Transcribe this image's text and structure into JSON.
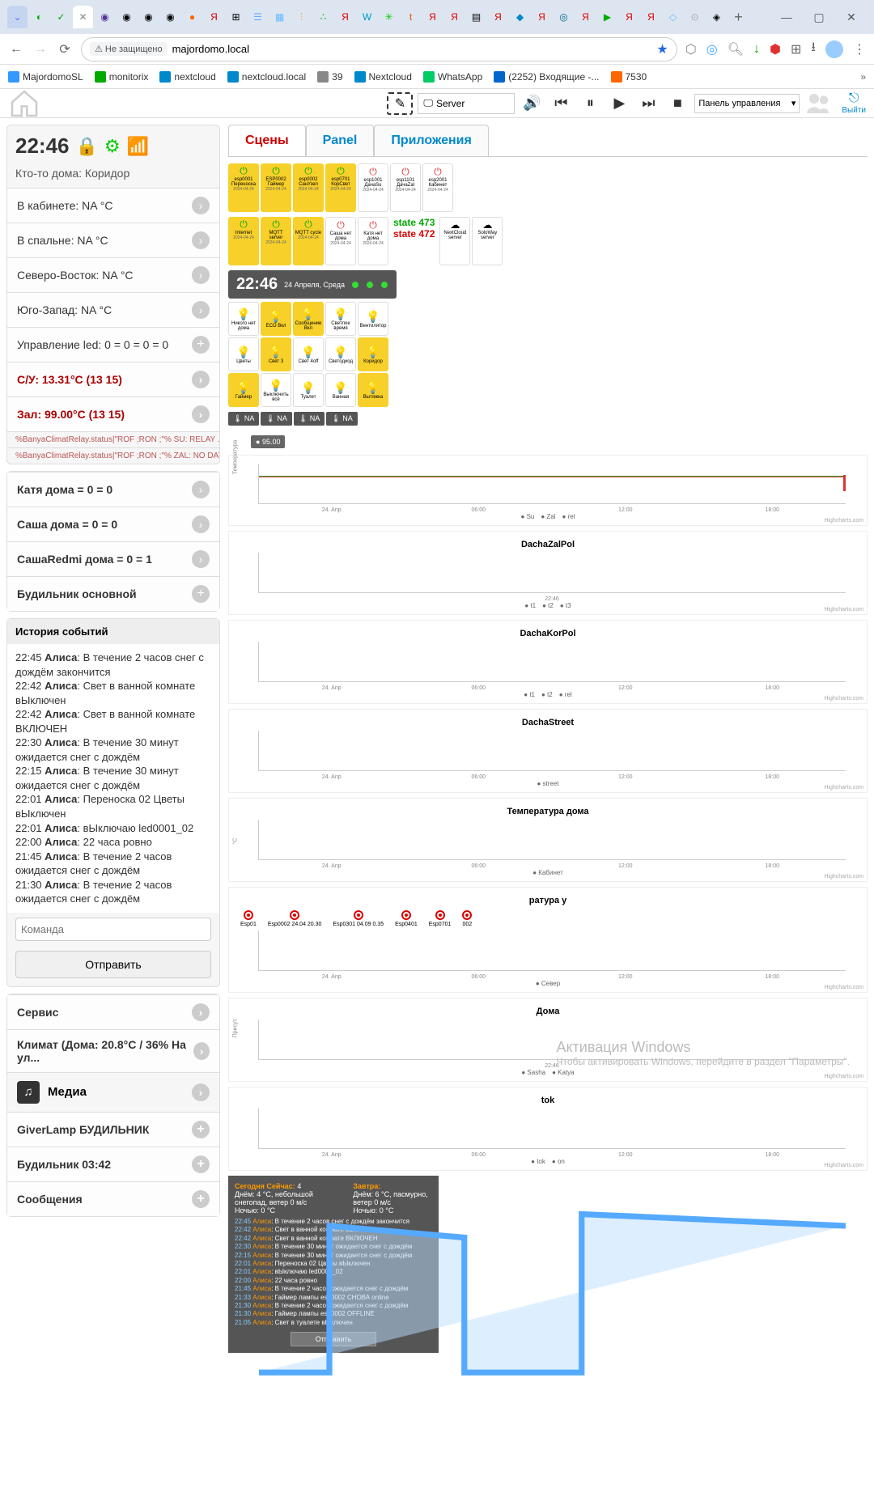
{
  "browser": {
    "url": "majordomo.local",
    "not_secure": "Не защищено",
    "win": {
      "min": "—",
      "max": "▢",
      "close": "✕"
    }
  },
  "bookmarks": [
    {
      "label": "MajordomoSL",
      "color": "#39f"
    },
    {
      "label": "monitorix",
      "color": "#0a0"
    },
    {
      "label": "nextcloud",
      "color": "#08c"
    },
    {
      "label": "nextcloud.local",
      "color": "#08c"
    },
    {
      "label": "39",
      "color": "#888"
    },
    {
      "label": "Nextcloud",
      "color": "#08c"
    },
    {
      "label": "WhatsApp",
      "color": "#0c6"
    },
    {
      "label": "(2252) Входящие -...",
      "color": "#06c"
    },
    {
      "label": "7530",
      "color": "#f60"
    }
  ],
  "topbar": {
    "server": "Server",
    "panel": "Панель управления",
    "logout": "Выйти"
  },
  "status": {
    "time": "22:46",
    "presence": "Кто-то дома: Коридор"
  },
  "rooms": [
    {
      "label": "В кабинете: NA °C",
      "type": "chev"
    },
    {
      "label": "В спальне: NA °C",
      "type": "chev"
    },
    {
      "label": "Северо-Восток: NA °C",
      "type": "chev"
    },
    {
      "label": "Юго-Запад: NA °C",
      "type": "chev"
    },
    {
      "label": "Управление led: 0 = 0 = 0 = 0",
      "type": "plus"
    },
    {
      "label": "С/У: 13.31°C (13 15)",
      "type": "chev",
      "red": true
    },
    {
      "label": "Зал: 99.00°C (13 15)",
      "type": "chev",
      "red": true
    }
  ],
  "warns": [
    "%BanyaClimatRelay.status|\"ROF ;RON ;\"% SU: RELAY ...",
    "%BanyaClimatRelay.status|\"ROF ;RON ;\"% ZAL: NO DAT..."
  ],
  "people": [
    {
      "label": "Катя дома = 0 = 0"
    },
    {
      "label": "Саша дома = 0 = 0"
    },
    {
      "label": "СашаRedmi дома = 0 = 1"
    }
  ],
  "alarm": "Будильник основной",
  "history_title": "История событий",
  "history": [
    {
      "t": "22:45",
      "who": "Алиса",
      "msg": "В течение 2 часов снег с дождём закончится"
    },
    {
      "t": "22:42",
      "who": "Алиса",
      "msg": "Свет в ванной комнате вЫключен"
    },
    {
      "t": "22:42",
      "who": "Алиса",
      "msg": "Свет в ванной комнате ВКЛЮЧЕН"
    },
    {
      "t": "22:30",
      "who": "Алиса",
      "msg": "В течение 30 минут ожидается снег с дождём"
    },
    {
      "t": "22:15",
      "who": "Алиса",
      "msg": "В течение 30 минут ожидается снег с дождём"
    },
    {
      "t": "22:01",
      "who": "Алиса",
      "msg": "Переноска 02 Цветы вЫключен"
    },
    {
      "t": "22:01",
      "who": "Алиса",
      "msg": "вЫключаю led0001_02"
    },
    {
      "t": "22:00",
      "who": "Алиса",
      "msg": "22 часа ровно"
    },
    {
      "t": "21:45",
      "who": "Алиса",
      "msg": "В течение 2 часов ожидается снег с дождём"
    },
    {
      "t": "21:30",
      "who": "Алиса",
      "msg": "В течение 2 часов ожидается снег с дождём"
    }
  ],
  "cmd_placeholder": "Команда",
  "send": "Отправить",
  "menu": [
    {
      "label": "Сервис",
      "icon": "chev"
    },
    {
      "label": "Климат (Дома: 20.8°C / 36% На ул...",
      "icon": "chev"
    },
    {
      "label": "Медиа",
      "icon": "media"
    },
    {
      "label": "GiverLamp БУДИЛЬНИК",
      "icon": "plus"
    },
    {
      "label": "Будильник 03:42",
      "icon": "plus"
    },
    {
      "label": "Сообщения",
      "icon": "plus"
    }
  ],
  "tabs": {
    "scenes": "Сцены",
    "panel": "Panel",
    "apps": "Приложения"
  },
  "devices_row1": [
    {
      "name": "esp0001 Переноска",
      "on": true
    },
    {
      "name": "ESP0002 Гаймер",
      "on": true
    },
    {
      "name": "esp0002 СанУзел",
      "on": true
    },
    {
      "name": "esp0701 КорСвет",
      "on": true
    },
    {
      "name": "esp1001 ДачаSu",
      "on": false
    },
    {
      "name": "esp1101 ДачаZal",
      "on": false
    },
    {
      "name": "esp2001 Кабинет",
      "on": false
    }
  ],
  "devices_row2": [
    {
      "name": "Internet",
      "on": true
    },
    {
      "name": "MQTT server",
      "on": true
    },
    {
      "name": "MQTT cycle",
      "on": true
    },
    {
      "name": "Саша нет дома",
      "on": false
    },
    {
      "name": "Катя нет дома",
      "on": false
    }
  ],
  "states": {
    "s1": "state 473",
    "s2": "state 472"
  },
  "srv_row": [
    {
      "name": "NextCloud server"
    },
    {
      "name": "SoloWay server"
    }
  ],
  "time_panel": {
    "time": "22:46",
    "date": "24 Апреля, Среда"
  },
  "controls": [
    {
      "name": "Никого нет дома",
      "on": false
    },
    {
      "name": "ECO Вкл",
      "on": true
    },
    {
      "name": "Сообщение Вкл",
      "on": true
    },
    {
      "name": "Светлое время",
      "on": false
    },
    {
      "name": "Вентилятор",
      "on": false
    },
    {
      "name": "Цветы",
      "on": false
    },
    {
      "name": "Свет 3",
      "on": true
    },
    {
      "name": "Свет 4off",
      "on": false
    },
    {
      "name": "Светодиод",
      "on": false
    },
    {
      "name": "Коридор",
      "on": true
    },
    {
      "name": "Гаймер",
      "on": true
    },
    {
      "name": "Выключить всё",
      "on": false
    },
    {
      "name": "Туалет",
      "on": false
    },
    {
      "name": "Ванная",
      "on": false
    },
    {
      "name": "Вытяжка",
      "on": true
    }
  ],
  "temps": [
    "NA",
    "NA",
    "NA",
    "NA"
  ],
  "temp_extra": "95.00",
  "chart_data": [
    {
      "type": "line",
      "title": "",
      "series": [
        {
          "name": "Su",
          "color": "#88f"
        },
        {
          "name": "Zal",
          "color": "#3a3"
        },
        {
          "name": "rel",
          "color": "#d33"
        }
      ],
      "x": [
        "24. Anp",
        "06:00",
        "12:00",
        "18:00"
      ],
      "ylabel": "Температура",
      "ylim": [
        -0.5,
        0.5
      ]
    },
    {
      "type": "line",
      "title": "DachaZalPol",
      "series": [
        {
          "name": "t1"
        },
        {
          "name": "t2"
        },
        {
          "name": "t3"
        }
      ],
      "x": [
        "22:46"
      ],
      "ylim": [
        15,
        20
      ]
    },
    {
      "type": "line",
      "title": "DachaKorPol",
      "series": [
        {
          "name": "t1"
        },
        {
          "name": "t2"
        },
        {
          "name": "rel"
        }
      ],
      "x": [
        "24. Anp",
        "06:00",
        "12:00",
        "18:00"
      ],
      "ylim": [
        0,
        100
      ]
    },
    {
      "type": "line",
      "title": "DachaStreet",
      "series": [
        {
          "name": "street"
        }
      ],
      "x": [
        "24. Anp",
        "06:00",
        "12:00",
        "18:00"
      ],
      "ylim": [
        -11.21,
        -11.21
      ]
    },
    {
      "type": "line",
      "title": "Температура дома",
      "series": [
        {
          "name": "Кабинет"
        }
      ],
      "x": [
        "24. Anp",
        "06:00",
        "12:00",
        "18:00"
      ],
      "ylabel": "°С"
    },
    {
      "type": "line",
      "title": "ратура у",
      "series": [
        {
          "name": "Север"
        }
      ],
      "x": [
        "24. Anp",
        "06:00",
        "12:00",
        "18:00"
      ]
    },
    {
      "type": "line",
      "title": "Дома",
      "series": [
        {
          "name": "Sasha"
        },
        {
          "name": "Katya"
        }
      ],
      "x": [
        "22:46"
      ],
      "ylabel": "Присут.",
      "ylim": [
        0,
        4
      ]
    },
    {
      "type": "area",
      "title": "tok",
      "series": [
        {
          "name": "tok"
        },
        {
          "name": "on"
        }
      ],
      "x": [
        "24. Anp",
        "06:00",
        "12:00",
        "18:00"
      ],
      "ylim": [
        0,
        1.6
      ]
    }
  ],
  "rec_labels": [
    "Esp01",
    "Esp0002 24.04 20.30",
    "Esp0301 04.09 0.35",
    "Esp0401",
    "Esp0701",
    "002"
  ],
  "weather": {
    "now_hdr": "Сегодня Сейчас:",
    "now_temp": "4",
    "now_desc": "Днём: 4 °C, небольшой снегопад, ветер 0 м/с",
    "now_night": "Ночью: 0 °C",
    "tom_hdr": "Завтра:",
    "tom_desc": "Днём: 6 °C, пасмурно, ветер 0 м/с",
    "tom_night": "Ночью: 0 °C",
    "log": [
      "22:45 Алиса: В течение 2 часов снег с дождём закончится",
      "22:42 Алиса: Свет в ванной комнате вЫключен",
      "22:42 Алиса: Свет в ванной комнате ВКЛЮЧЕН",
      "22:30 Алиса: В течение 30 минут ожидается снег с дождём",
      "22:15 Алиса: В течение 30 минут ожидается снег с дождём",
      "22:01 Алиса: Переноска 02 Цветы вЫключен",
      "22:01 Алиса: вЫключаю led0001_02",
      "22:00 Алиса: 22 часа ровно",
      "21:45 Алиса: В течение 2 часов ожидается снег с дождём",
      "21:33 Алиса: Гаймер лампы esp0002 СНОВА online",
      "21:30 Алиса: В течение 2 часов ожидается снег с дождём",
      "21:30 Алиса: Гаймер лампы esp0002 OFFLINE",
      "21:05 Алиса: Свет в туалете вЫключен"
    ],
    "btn": "Отправить"
  },
  "watermark": {
    "title": "Активация Windows",
    "sub": "Чтобы активировать Windows, перейдите в раздел \"Параметры\"."
  }
}
